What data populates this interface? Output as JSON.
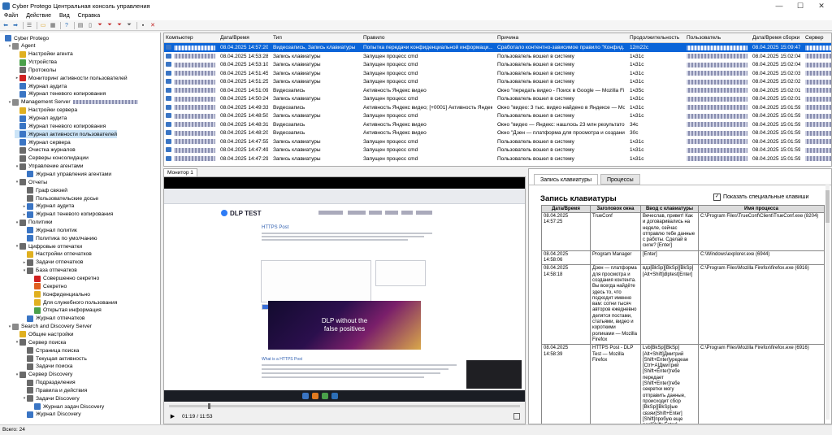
{
  "window": {
    "title": "Cyber Protego Центральная консоль управления",
    "minimize": "—",
    "maximize": "☐",
    "close": "✕"
  },
  "menu": [
    "Файл",
    "Действие",
    "Вид",
    "Справка"
  ],
  "toolbar": {
    "icons": [
      "back-icon",
      "forward-icon",
      "sep",
      "list-icon",
      "sep",
      "folder-icon",
      "grid-icon",
      "sep",
      "help-icon",
      "sep",
      "report-icon",
      "doc-icon",
      "filter-red-icon",
      "filter-red-icon",
      "filter-red-icon",
      "filter-icon",
      "sep",
      "save-icon",
      "delete-icon"
    ]
  },
  "tree": [
    {
      "label": "Cyber Protego",
      "indent": 0,
      "icon": "#3a75c4",
      "exp": ""
    },
    {
      "label": "Agent",
      "indent": 1,
      "icon": "#8a8a8a",
      "exp": "v"
    },
    {
      "label": "Настройки агента",
      "indent": 2,
      "icon": "#e0b020",
      "exp": ""
    },
    {
      "label": "Устройства",
      "indent": 2,
      "icon": "#4aa04a",
      "exp": ""
    },
    {
      "label": "Протоколы",
      "indent": 2,
      "icon": "#6a6a6a",
      "exp": ""
    },
    {
      "label": "Мониторинг активности пользователей",
      "indent": 2,
      "icon": "#d02020",
      "exp": ">"
    },
    {
      "label": "Журнал аудита",
      "indent": 2,
      "icon": "#3a75c4",
      "exp": ""
    },
    {
      "label": "Журнал теневого копирования",
      "indent": 2,
      "icon": "#3a75c4",
      "exp": ""
    },
    {
      "label": "Management Server",
      "indent": 1,
      "icon": "#8a8a8a",
      "exp": "v",
      "blur": true
    },
    {
      "label": "Настройки сервера",
      "indent": 2,
      "icon": "#e0b020",
      "exp": ""
    },
    {
      "label": "Журнал аудита",
      "indent": 2,
      "icon": "#3a75c4",
      "exp": ""
    },
    {
      "label": "Журнал теневого копирования",
      "indent": 2,
      "icon": "#3a75c4",
      "exp": ""
    },
    {
      "label": "Журнал активности пользователей",
      "indent": 2,
      "icon": "#3a75c4",
      "exp": "",
      "selected": true
    },
    {
      "label": "Журнал сервера",
      "indent": 2,
      "icon": "#3a75c4",
      "exp": ""
    },
    {
      "label": "Очистка журналов",
      "indent": 2,
      "icon": "#6a6a6a",
      "exp": ""
    },
    {
      "label": "Серверы консолидации",
      "indent": 2,
      "icon": "#6a6a6a",
      "exp": ""
    },
    {
      "label": "Управление агентами",
      "indent": 2,
      "icon": "#6a6a6a",
      "exp": "v"
    },
    {
      "label": "Журнал управления агентами",
      "indent": 3,
      "icon": "#3a75c4",
      "exp": ""
    },
    {
      "label": "Отчеты",
      "indent": 2,
      "icon": "#6a6a6a",
      "exp": "v"
    },
    {
      "label": "Граф связей",
      "indent": 3,
      "icon": "#6a6a6a",
      "exp": ""
    },
    {
      "label": "Пользовательские досье",
      "indent": 3,
      "icon": "#6a6a6a",
      "exp": ""
    },
    {
      "label": "Журнал аудита",
      "indent": 3,
      "icon": "#3a75c4",
      "exp": ">"
    },
    {
      "label": "Журнал теневого копирования",
      "indent": 3,
      "icon": "#3a75c4",
      "exp": ">"
    },
    {
      "label": "Политики",
      "indent": 2,
      "icon": "#6a6a6a",
      "exp": "v"
    },
    {
      "label": "Журнал политик",
      "indent": 3,
      "icon": "#3a75c4",
      "exp": ""
    },
    {
      "label": "Политика по умолчанию",
      "indent": 3,
      "icon": "#3a75c4",
      "exp": ""
    },
    {
      "label": "Цифровые отпечатки",
      "indent": 2,
      "icon": "#6a6a6a",
      "exp": "v"
    },
    {
      "label": "Настройки отпечатков",
      "indent": 3,
      "icon": "#e0b020",
      "exp": ""
    },
    {
      "label": "Задачи отпечатков",
      "indent": 3,
      "icon": "#6a6a6a",
      "exp": ">"
    },
    {
      "label": "База отпечатков",
      "indent": 3,
      "icon": "#6a6a6a",
      "exp": "v"
    },
    {
      "label": "Совершенно секретно",
      "indent": 4,
      "icon": "#d02020",
      "exp": ""
    },
    {
      "label": "Секретно",
      "indent": 4,
      "icon": "#e06020",
      "exp": ""
    },
    {
      "label": "Конфиденциально",
      "indent": 4,
      "icon": "#e0b020",
      "exp": ""
    },
    {
      "label": "Для служебного пользования",
      "indent": 4,
      "icon": "#e0b020",
      "exp": ""
    },
    {
      "label": "Открытая информация",
      "indent": 4,
      "icon": "#4aa04a",
      "exp": ""
    },
    {
      "label": "Журнал отпечатков",
      "indent": 3,
      "icon": "#3a75c4",
      "exp": ""
    },
    {
      "label": "Search and Discovery Server",
      "indent": 1,
      "icon": "#8a8a8a",
      "exp": "v"
    },
    {
      "label": "Общие настройки",
      "indent": 2,
      "icon": "#e0b020",
      "exp": ""
    },
    {
      "label": "Сервер поиска",
      "indent": 2,
      "icon": "#6a6a6a",
      "exp": "v"
    },
    {
      "label": "Страница поиска",
      "indent": 3,
      "icon": "#6a6a6a",
      "exp": ""
    },
    {
      "label": "Текущая активность",
      "indent": 3,
      "icon": "#6a6a6a",
      "exp": ""
    },
    {
      "label": "Задачи поиска",
      "indent": 3,
      "icon": "#6a6a6a",
      "exp": ""
    },
    {
      "label": "Сервер Discovery",
      "indent": 2,
      "icon": "#6a6a6a",
      "exp": "v"
    },
    {
      "label": "Подразделения",
      "indent": 3,
      "icon": "#6a6a6a",
      "exp": ""
    },
    {
      "label": "Правила и действия",
      "indent": 3,
      "icon": "#6a6a6a",
      "exp": ""
    },
    {
      "label": "Задачи Discovery",
      "indent": 3,
      "icon": "#6a6a6a",
      "exp": "v"
    },
    {
      "label": "Журнал задач Discovery",
      "indent": 4,
      "icon": "#3a75c4",
      "exp": ""
    },
    {
      "label": "Журнал Discovery",
      "indent": 3,
      "icon": "#3a75c4",
      "exp": ""
    }
  ],
  "grid": {
    "columns": [
      "Компьютер",
      "Дата/Время",
      "Тип",
      "Правило",
      "Причина",
      "Продолжительность",
      "Пользователь",
      "Дата/Время сборки",
      "Сервер"
    ],
    "rows": [
      {
        "date": "08.04.2025 14:57:20",
        "type": "Видеозапись, Запись клавиатуры",
        "rule": "Попытка передачи конфиденциальной информаци...",
        "reason": "Сработало контентно-зависимое правило \"Конфид...",
        "dur": "12m22c",
        "build": "08.04.2025 15:09:47",
        "selected": true
      },
      {
        "date": "08.04.2025 14:53:28",
        "type": "Запись клавиатуры",
        "rule": "Запущен процесс cmd",
        "reason": "Пользователь вошел в систему",
        "dur": "1ч31с",
        "build": "08.04.2025 15:02:04"
      },
      {
        "date": "08.04.2025 14:53:10",
        "type": "Запись клавиатуры",
        "rule": "Запущен процесс cmd",
        "reason": "Пользователь вошел в систему",
        "dur": "1ч31с",
        "build": "08.04.2025 15:02:04"
      },
      {
        "date": "08.04.2025 14:51:45",
        "type": "Запись клавиатуры",
        "rule": "Запущен процесс cmd",
        "reason": "Пользователь вошел в систему",
        "dur": "1ч31с",
        "build": "08.04.2025 15:02:03"
      },
      {
        "date": "08.04.2025 14:51:25",
        "type": "Запись клавиатуры",
        "rule": "Запущен процесс cmd",
        "reason": "Пользователь вошел в систему",
        "dur": "1ч31с",
        "build": "08.04.2025 15:02:02"
      },
      {
        "date": "08.04.2025 14:51:09",
        "type": "Видеозапись",
        "rule": "Активность Яндекс видео",
        "reason": "Окно \"передать видео - Поиск в Google — Mozilla Fi...",
        "dur": "1ч35с",
        "build": "08.04.2025 15:02:01"
      },
      {
        "date": "08.04.2025 14:50:24",
        "type": "Запись клавиатуры",
        "rule": "Запущен процесс cmd",
        "reason": "Пользователь вошел в систему",
        "dur": "1ч31с",
        "build": "08.04.2025 15:02:01"
      },
      {
        "date": "08.04.2025 14:49:33",
        "type": "Видеозапись",
        "rule": "Активность Яндекс видео; [+0001] Активность Яндекс видео",
        "reason": "Окно \"видео: 3 тыс. видео найдено в Яндексе — Моз...",
        "dur": "1ч31с",
        "build": "08.04.2025 15:01:59"
      },
      {
        "date": "08.04.2025 14:48:50",
        "type": "Запись клавиатуры",
        "rule": "Запущен процесс cmd",
        "reason": "Пользователь вошел в систему",
        "dur": "1ч31с",
        "build": "08.04.2025 15:01:59"
      },
      {
        "date": "08.04.2025 14:48:31",
        "type": "Видеозапись",
        "rule": "Активность Яндекс видео",
        "reason": "Окно \"видео — Яндекс: нашлось 23 млн результатов...",
        "dur": "34с",
        "build": "08.04.2025 15:01:59"
      },
      {
        "date": "08.04.2025 14:48:20",
        "type": "Видеозапись",
        "rule": "Активность Яндекс видео",
        "reason": "Окно \"Дзен — платформа для просмотра и создани...",
        "dur": "30с",
        "build": "08.04.2025 15:01:59"
      },
      {
        "date": "08.04.2025 14:47:55",
        "type": "Запись клавиатуры",
        "rule": "Запущен процесс cmd",
        "reason": "Пользователь вошел в систему",
        "dur": "1ч31с",
        "build": "08.04.2025 15:01:59"
      },
      {
        "date": "08.04.2025 14:47:49",
        "type": "Запись клавиатуры",
        "rule": "Запущен процесс cmd",
        "reason": "Пользователь вошел в систему",
        "dur": "1ч31с",
        "build": "08.04.2025 15:01:59"
      },
      {
        "date": "08.04.2025 14:47:29",
        "type": "Запись клавиатуры",
        "rule": "Запущен процесс cmd",
        "reason": "Пользователь вошел в систему",
        "dur": "1ч31с",
        "build": "08.04.2025 15:01:59"
      }
    ]
  },
  "monitor": {
    "tab": "Монитор 1",
    "time": "01:19 / 11:53",
    "progress": 0.11,
    "screen": {
      "logo": "DLP TEST",
      "page_heading": "HTTPS Post",
      "banner_line1": "DLP without the",
      "banner_line2": "false positives",
      "section": "What is a HTTPS Post"
    }
  },
  "details": {
    "tabs": [
      "Запись клавиатуры",
      "Процессы"
    ],
    "title": "Запись клавиатуры",
    "checkbox": "Показать специальные клавиши",
    "table_headers": [
      "Дата/Время",
      "Заголовок окна",
      "Ввод с клавиатуры",
      "Имя процесса"
    ],
    "rows": [
      {
        "date": "08.04.2025 14:57:25",
        "window": "TrueConf",
        "input": "Вечеслав, привет! Как и договаривались на неделе, сейчас отправлю тебе данные с работы. Сделай в силе? [Enter]",
        "process": "C:\\Program Files\\TrueConf\\Client\\TrueConf.exe (8204)"
      },
      {
        "date": "08.04.2025 14:58:06",
        "window": "Program Manager",
        "input": "[Enter]",
        "process": "C:\\Windows\\explorer.exe (6944)"
      },
      {
        "date": "08.04.2025 14:58:18",
        "window": "Дзен — платформа для просмотра и создания контента. Вы всегда найдёте здесь то, что подходит именно вам: сотни тысяч авторов ежедневно делятся постами, статьями, видео и короткими роликами — Mozilla Firefox",
        "input": "вдз[BkSp][BkSp][BkSp][Alt+Shift]dlptest[Enter]",
        "process": "C:\\Program Files\\Mozilla Firefox\\firefox.exe (6916)"
      },
      {
        "date": "08.04.2025 14:58:39",
        "window": "HTTPS Post - DLP Test — Mozilla Firefox",
        "input": "Lvb[BkSp][BkSp][Alt+Shift]Дмитрий [Shift+Enter]уредеae [Ctrl+A]Дмитрий [Shift+Enter]тебе передает [Shift+Enter]тебе секретки могу отправить данные, происходит сбор [BkSp][BkSp]ые свзяи[Shift+Enter] [Shift]пробую еще раз[Shift+Enter]",
        "process": "C:\\Program Files\\Mozilla Firefox\\firefox.exe (6916)"
      }
    ]
  },
  "status": "Всего: 24"
}
